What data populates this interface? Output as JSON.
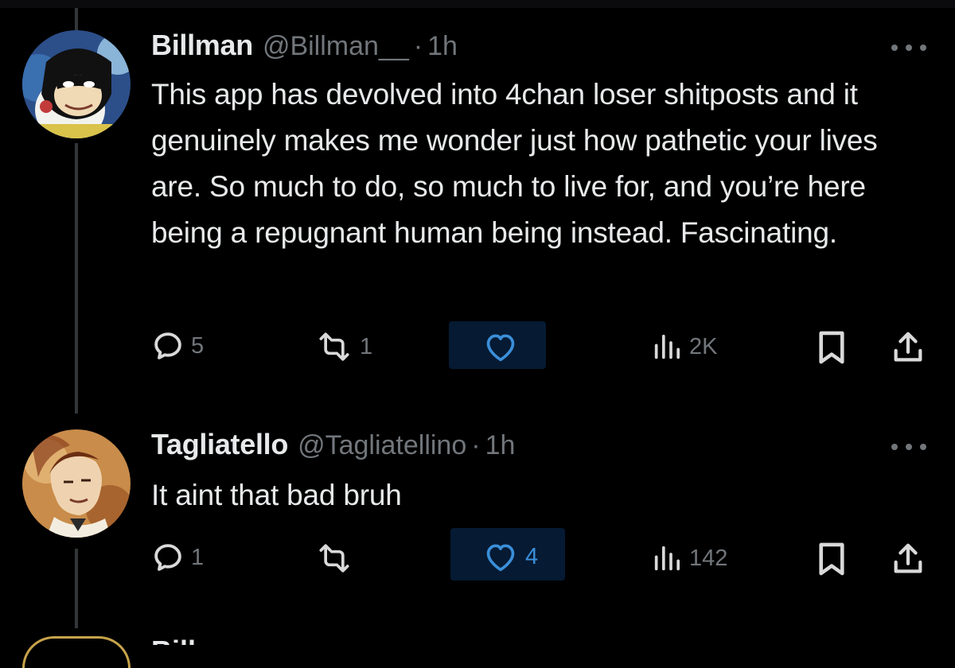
{
  "tweets": [
    {
      "display_name": "Billman",
      "handle": "@Billman__",
      "separator": "·",
      "time": "1h",
      "text": "This app has devolved into 4chan loser shitposts and it genuinely makes me wonder just how pathetic your lives are. So much to do, so much to live for, and you’re here being a repugnant human being instead. Fascinating.",
      "replies": "5",
      "reposts": "1",
      "likes": "",
      "views": "2K",
      "avatar_icon": "space-ghost-avatar"
    },
    {
      "display_name": "Tagliatello",
      "handle": "@Tagliatellino",
      "separator": "·",
      "time": "1h",
      "text": "It aint that bad bruh",
      "replies": "1",
      "reposts": "",
      "likes": "4",
      "views": "142",
      "avatar_icon": "painted-portrait-avatar"
    }
  ],
  "next_tweet_partial_name": "Bill",
  "colors": {
    "background": "#000000",
    "text": "#e7e9ea",
    "secondary": "#71767b",
    "like_accent": "#1d9bf0",
    "thread_line": "#333639"
  },
  "icons": [
    "reply-icon",
    "repost-icon",
    "like-icon",
    "views-icon",
    "bookmark-icon",
    "share-icon",
    "more-icon"
  ]
}
